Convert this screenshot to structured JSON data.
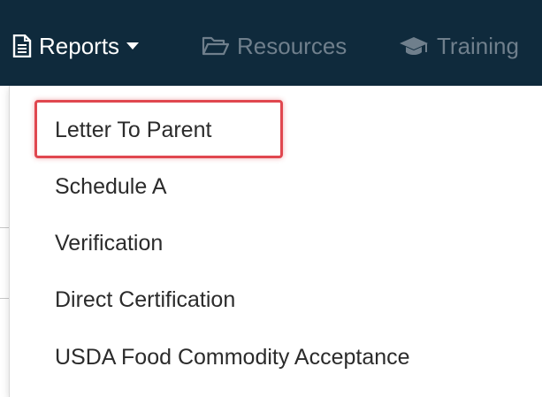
{
  "navbar": {
    "items": [
      {
        "label": "Reports",
        "icon": "document-icon",
        "active": true
      },
      {
        "label": "Resources",
        "icon": "folder-open-icon",
        "active": false
      },
      {
        "label": "Training",
        "icon": "graduation-cap-icon",
        "active": false
      }
    ]
  },
  "dropdown": {
    "items": [
      {
        "label": "Letter To Parent",
        "highlighted": true
      },
      {
        "label": "Schedule A"
      },
      {
        "label": "Verification"
      },
      {
        "label": "Direct Certification"
      },
      {
        "label": "USDA Food Commodity Acceptance"
      }
    ]
  },
  "colors": {
    "navbar_bg": "#0f2a3c",
    "nav_active_text": "#ffffff",
    "nav_inactive_text": "#6f7f8c",
    "highlight_border": "#e0474f",
    "menu_text": "#2b2b2b"
  }
}
